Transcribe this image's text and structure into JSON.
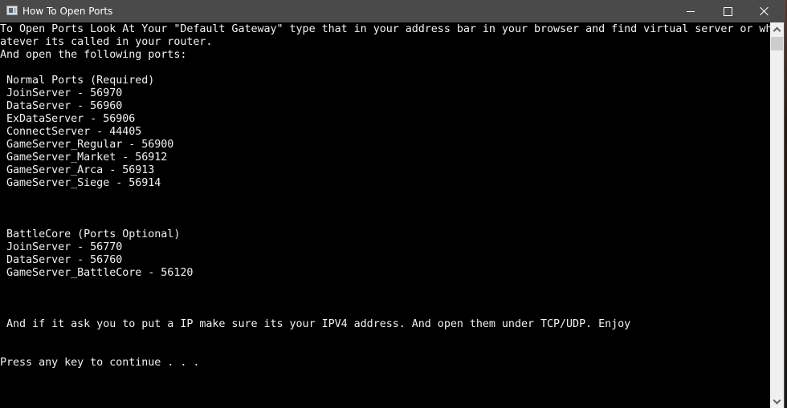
{
  "window": {
    "title": "How To Open Ports",
    "icon": "console-app-icon",
    "controls": {
      "minimize": "minimize-icon",
      "maximize": "maximize-icon",
      "close": "close-icon"
    }
  },
  "console": {
    "lines": [
      "To Open Ports Look At Your \"Default Gateway\" type that in your address bar in your browser and find virtual server or wh",
      "atever its called in your router.",
      "And open the following ports:",
      "",
      " Normal Ports (Required)",
      " JoinServer - 56970",
      " DataServer - 56960",
      " ExDataServer - 56906",
      " ConnectServer - 44405",
      " GameServer_Regular - 56900",
      " GameServer_Market - 56912",
      " GameServer_Arca - 56913",
      " GameServer_Siege - 56914",
      "",
      "",
      "",
      " BattleCore (Ports Optional)",
      " JoinServer - 56770",
      " DataServer - 56760",
      " GameServer_BattleCore - 56120",
      "",
      "",
      "",
      " And if it ask you to put a IP make sure its your IPV4 address. And open them under TCP/UDP. Enjoy",
      "",
      "",
      "Press any key to continue . . ."
    ]
  },
  "scrollbar": {
    "position": 0
  },
  "colors": {
    "titlebar": "#4a4a4a",
    "console_bg": "#000000",
    "console_fg": "#f2f2f2",
    "scrollbar_track": "#f0f0f0",
    "scrollbar_thumb": "#cdcdcd"
  }
}
